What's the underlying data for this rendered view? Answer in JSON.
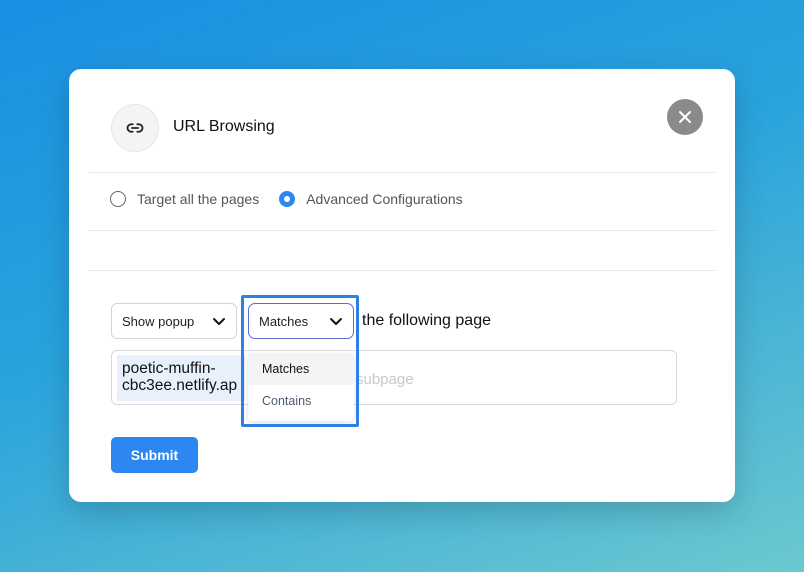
{
  "modal": {
    "title": "URL Browsing",
    "header_icon": "link-icon",
    "close_icon": "close-icon"
  },
  "targeting": {
    "options": [
      {
        "label": "Target all the pages",
        "selected": false
      },
      {
        "label": "Advanced Configurations",
        "selected": true
      }
    ]
  },
  "rule": {
    "action_select": {
      "value": "Show popup"
    },
    "match_select": {
      "value": "Matches",
      "options": [
        "Matches",
        "Contains"
      ]
    },
    "suffix_text": "the following page"
  },
  "url_input": {
    "domain_line1": "poetic-muffin-",
    "domain_line2": "cbc3ee.netlify.ap",
    "placeholder": "subpage"
  },
  "submit_label": "Submit",
  "colors": {
    "accent": "#2d87f0",
    "highlight_frame": "#2f7fe5",
    "close_button": "#8a8a8a"
  }
}
